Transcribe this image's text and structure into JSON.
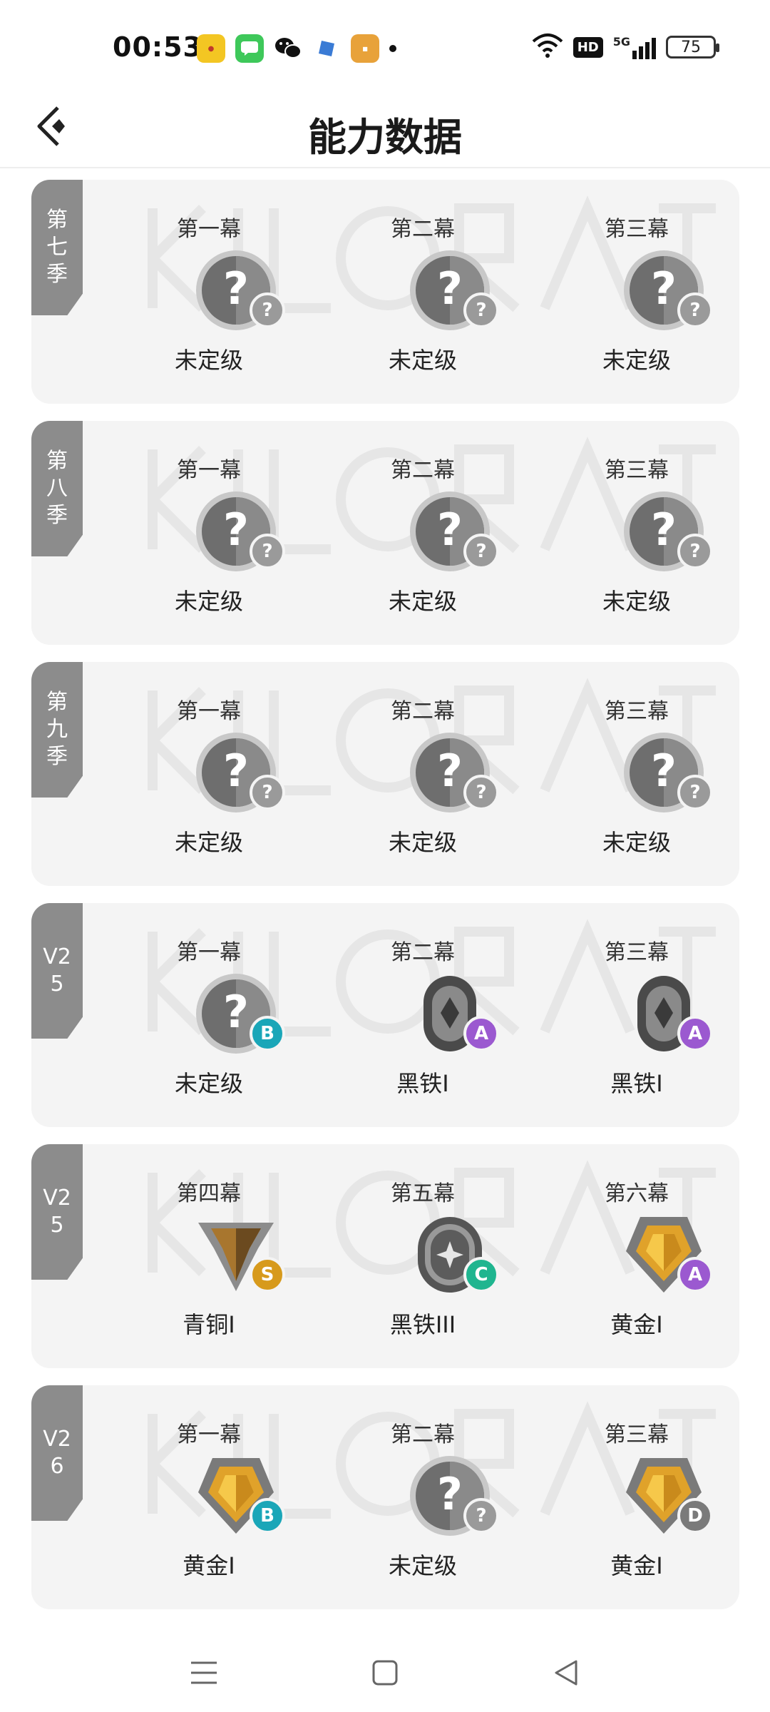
{
  "status_bar": {
    "time": "00:53",
    "network": "5G",
    "hd": "HD",
    "battery": "75"
  },
  "header": {
    "title": "能力数据"
  },
  "seasons": [
    {
      "label": "第七季",
      "acts": [
        {
          "act": "第一幕",
          "rank": "未定级",
          "rank_icon": "unranked-icon",
          "tier": "?",
          "tier_color": "#9a9a9a"
        },
        {
          "act": "第二幕",
          "rank": "未定级",
          "rank_icon": "unranked-icon",
          "tier": "?",
          "tier_color": "#9a9a9a"
        },
        {
          "act": "第三幕",
          "rank": "未定级",
          "rank_icon": "unranked-icon",
          "tier": "?",
          "tier_color": "#9a9a9a"
        }
      ]
    },
    {
      "label": "第八季",
      "acts": [
        {
          "act": "第一幕",
          "rank": "未定级",
          "rank_icon": "unranked-icon",
          "tier": "?",
          "tier_color": "#9a9a9a"
        },
        {
          "act": "第二幕",
          "rank": "未定级",
          "rank_icon": "unranked-icon",
          "tier": "?",
          "tier_color": "#9a9a9a"
        },
        {
          "act": "第三幕",
          "rank": "未定级",
          "rank_icon": "unranked-icon",
          "tier": "?",
          "tier_color": "#9a9a9a"
        }
      ]
    },
    {
      "label": "第九季",
      "acts": [
        {
          "act": "第一幕",
          "rank": "未定级",
          "rank_icon": "unranked-icon",
          "tier": "?",
          "tier_color": "#9a9a9a"
        },
        {
          "act": "第二幕",
          "rank": "未定级",
          "rank_icon": "unranked-icon",
          "tier": "?",
          "tier_color": "#9a9a9a"
        },
        {
          "act": "第三幕",
          "rank": "未定级",
          "rank_icon": "unranked-icon",
          "tier": "?",
          "tier_color": "#9a9a9a"
        }
      ]
    },
    {
      "label": "V25",
      "acts": [
        {
          "act": "第一幕",
          "rank": "未定级",
          "rank_icon": "unranked-icon",
          "tier": "B",
          "tier_color": "#1aa6b8"
        },
        {
          "act": "第二幕",
          "rank": "黑铁I",
          "rank_icon": "iron-icon",
          "tier": "A",
          "tier_color": "#9b59d0"
        },
        {
          "act": "第三幕",
          "rank": "黑铁I",
          "rank_icon": "iron-icon",
          "tier": "A",
          "tier_color": "#9b59d0"
        }
      ]
    },
    {
      "label": "V25",
      "acts": [
        {
          "act": "第四幕",
          "rank": "青铜I",
          "rank_icon": "bronze-icon",
          "tier": "S",
          "tier_color": "#d79a1c"
        },
        {
          "act": "第五幕",
          "rank": "黑铁III",
          "rank_icon": "iron3-icon",
          "tier": "C",
          "tier_color": "#1fb58f"
        },
        {
          "act": "第六幕",
          "rank": "黄金I",
          "rank_icon": "gold-icon",
          "tier": "A",
          "tier_color": "#9b59d0"
        }
      ]
    },
    {
      "label": "V26",
      "acts": [
        {
          "act": "第一幕",
          "rank": "黄金I",
          "rank_icon": "gold-icon",
          "tier": "B",
          "tier_color": "#1aa6b8"
        },
        {
          "act": "第二幕",
          "rank": "未定级",
          "rank_icon": "unranked-icon",
          "tier": "?",
          "tier_color": "#9a9a9a"
        },
        {
          "act": "第三幕",
          "rank": "黄金I",
          "rank_icon": "gold-icon",
          "tier": "D",
          "tier_color": "#7a7a7a"
        }
      ]
    }
  ]
}
